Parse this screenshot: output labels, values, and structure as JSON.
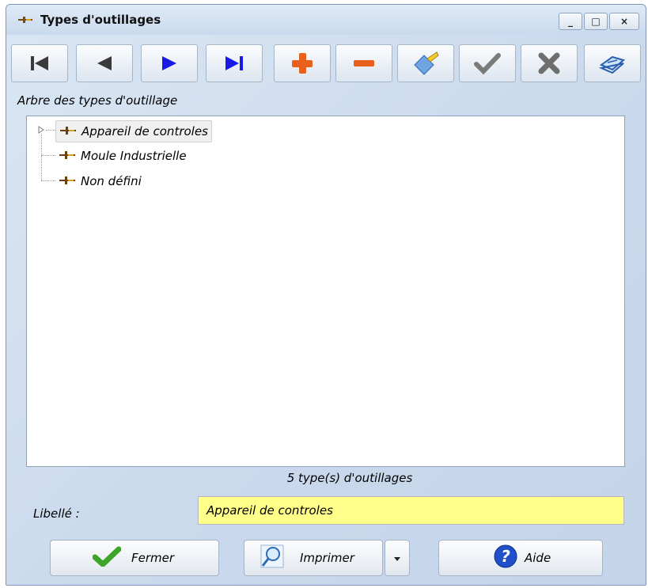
{
  "window": {
    "title": "Types d'outillages",
    "controls": {
      "minimize": "_",
      "maximize": "□",
      "close": "×"
    }
  },
  "toolbar": {
    "buttons": [
      {
        "name": "first-record",
        "icon": "skip-first-icon"
      },
      {
        "name": "previous-record",
        "icon": "triangle-left-icon"
      },
      {
        "name": "next-record",
        "icon": "triangle-right-icon"
      },
      {
        "name": "last-record",
        "icon": "skip-last-icon"
      },
      {
        "name": "add",
        "icon": "plus-icon"
      },
      {
        "name": "delete",
        "icon": "minus-icon"
      },
      {
        "name": "edit",
        "icon": "brush-icon"
      },
      {
        "name": "validate",
        "icon": "checkmark-icon"
      },
      {
        "name": "cancel",
        "icon": "x-icon"
      },
      {
        "name": "print",
        "icon": "book-icon"
      }
    ]
  },
  "tree": {
    "label": "Arbre des types d'outillage",
    "nodes": [
      {
        "label": "Appareil de controles",
        "selected": true,
        "expandable": true
      },
      {
        "label": "Moule Industrielle",
        "selected": false,
        "expandable": false
      },
      {
        "label": "Non défini",
        "selected": false,
        "expandable": false
      }
    ]
  },
  "status": {
    "count_text": "5 type(s) d'outillages"
  },
  "form": {
    "libelle_label": "Libellé :",
    "libelle_value": "Appareil de controles"
  },
  "buttons": {
    "close_label": "Fermer",
    "print_label": "Imprimer",
    "help_label": "Aide"
  },
  "colors": {
    "nav_blue": "#1a1ae6",
    "add_orange": "#e8601c",
    "input_yellow": "#ffff8a",
    "check_green": "#3da52a",
    "help_blue": "#1f4fc9"
  }
}
